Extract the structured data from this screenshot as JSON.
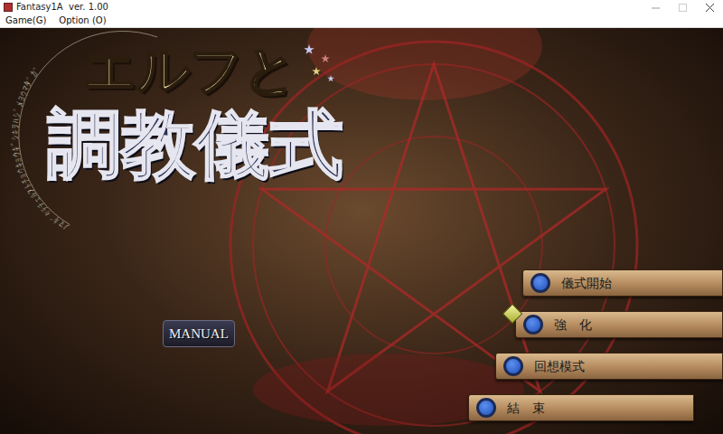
{
  "window": {
    "title": "Fantasy1A  ver. 1.00"
  },
  "menu_bar": [
    "Game(G)",
    "Option (O)"
  ],
  "logo": {
    "line1": "エルフと",
    "line2": "調教儀式",
    "rune_ring": "ﾉﾏｷﾞﾀﾃﾁｪﾙﾌﾄﾁｮｳｷｮｳｷﾞｼｷｦﾊｼﾞﾒﾖｳﾏﾀﾞｶﾞ"
  },
  "manual_button": "MANUAL",
  "menu": [
    {
      "label": "儀式開始",
      "selected": false
    },
    {
      "label": "強　化",
      "selected": true
    },
    {
      "label": "回想模式",
      "selected": false
    },
    {
      "label": "結　束",
      "selected": false
    }
  ]
}
